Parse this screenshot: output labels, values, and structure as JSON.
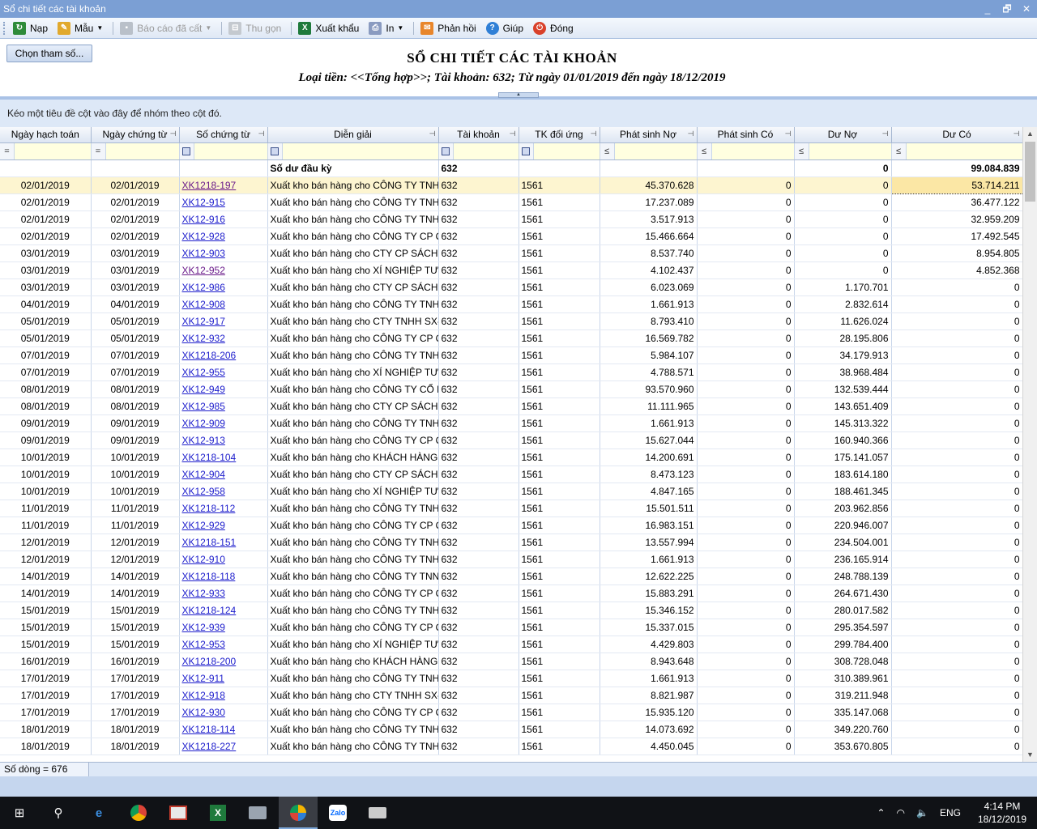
{
  "window": {
    "title": "Sổ chi tiết các tài khoản",
    "minimize": "_",
    "restore": "🗗",
    "close": "✕"
  },
  "toolbar": {
    "nap": "Nạp",
    "mau": "Mẫu",
    "saved_reports": "Báo cáo đã cất",
    "collapse": "Thu gọn",
    "export": "Xuất khẩu",
    "print": "In",
    "feedback": "Phản hồi",
    "help": "Giúp",
    "close": "Đóng"
  },
  "params_button": "Chọn tham số...",
  "report": {
    "title": "SỔ CHI TIẾT CÁC TÀI KHOẢN",
    "subtitle": "Loại tiền: <<Tổng hợp>>; Tài khoản: 632; Từ ngày 01/01/2019 đến ngày 18/12/2019"
  },
  "group_hint": "Kéo một tiêu đề cột vào đây để nhóm theo cột đó.",
  "columns": [
    "Ngày hạch toán",
    "Ngày chứng từ",
    "Số chứng từ",
    "Diễn giải",
    "Tài khoản",
    "TK đối ứng",
    "Phát sinh Nợ",
    "Phát sinh Có",
    "Dư Nợ",
    "Dư Có"
  ],
  "filter_ops": [
    "=",
    "=",
    "",
    "",
    "",
    "",
    "≤",
    "≤",
    "≤",
    "≤"
  ],
  "opening": {
    "label": "Số dư đầu kỳ",
    "account": "632",
    "debit_balance": "0",
    "credit_balance": "99.084.839"
  },
  "rows": [
    [
      "02/01/2019",
      "02/01/2019",
      "XK1218-197",
      "Xuất kho bán hàng cho CÔNG TY TNH",
      "632",
      "1561",
      "45.370.628",
      "0",
      "0",
      "53.714.211"
    ],
    [
      "02/01/2019",
      "02/01/2019",
      "XK12-915",
      "Xuất kho bán hàng cho CÔNG TY TNH",
      "632",
      "1561",
      "17.237.089",
      "0",
      "0",
      "36.477.122"
    ],
    [
      "02/01/2019",
      "02/01/2019",
      "XK12-916",
      "Xuất kho bán hàng cho CÔNG TY TNH",
      "632",
      "1561",
      "3.517.913",
      "0",
      "0",
      "32.959.209"
    ],
    [
      "02/01/2019",
      "02/01/2019",
      "XK12-928",
      "Xuất kho bán hàng cho CÔNG TY CP Q",
      "632",
      "1561",
      "15.466.664",
      "0",
      "0",
      "17.492.545"
    ],
    [
      "03/01/2019",
      "03/01/2019",
      "XK12-903",
      "Xuất kho bán hàng cho CTY CP SÁCH",
      "632",
      "1561",
      "8.537.740",
      "0",
      "0",
      "8.954.805"
    ],
    [
      "03/01/2019",
      "03/01/2019",
      "XK12-952",
      "Xuất kho bán hàng cho XÍ NGHIỆP TƯ",
      "632",
      "1561",
      "4.102.437",
      "0",
      "0",
      "4.852.368"
    ],
    [
      "03/01/2019",
      "03/01/2019",
      "XK12-986",
      "Xuất kho bán hàng cho CTY CP SÁCH",
      "632",
      "1561",
      "6.023.069",
      "0",
      "1.170.701",
      "0"
    ],
    [
      "04/01/2019",
      "04/01/2019",
      "XK12-908",
      "Xuất kho bán hàng cho CÔNG TY TNH",
      "632",
      "1561",
      "1.661.913",
      "0",
      "2.832.614",
      "0"
    ],
    [
      "05/01/2019",
      "05/01/2019",
      "XK12-917",
      "Xuất kho bán hàng cho CTY TNHH SX-",
      "632",
      "1561",
      "8.793.410",
      "0",
      "11.626.024",
      "0"
    ],
    [
      "05/01/2019",
      "05/01/2019",
      "XK12-932",
      "Xuất kho bán hàng cho CÔNG TY CP Q",
      "632",
      "1561",
      "16.569.782",
      "0",
      "28.195.806",
      "0"
    ],
    [
      "07/01/2019",
      "07/01/2019",
      "XK1218-206",
      "Xuất kho bán hàng cho CÔNG TY TNH",
      "632",
      "1561",
      "5.984.107",
      "0",
      "34.179.913",
      "0"
    ],
    [
      "07/01/2019",
      "07/01/2019",
      "XK12-955",
      "Xuất kho bán hàng cho XÍ NGHIỆP TƯ",
      "632",
      "1561",
      "4.788.571",
      "0",
      "38.968.484",
      "0"
    ],
    [
      "08/01/2019",
      "08/01/2019",
      "XK12-949",
      "Xuất kho bán hàng cho CÔNG TY CỔ P",
      "632",
      "1561",
      "93.570.960",
      "0",
      "132.539.444",
      "0"
    ],
    [
      "08/01/2019",
      "08/01/2019",
      "XK12-985",
      "Xuất kho bán hàng cho CTY CP SÁCH",
      "632",
      "1561",
      "11.111.965",
      "0",
      "143.651.409",
      "0"
    ],
    [
      "09/01/2019",
      "09/01/2019",
      "XK12-909",
      "Xuất kho bán hàng cho CÔNG TY TNH",
      "632",
      "1561",
      "1.661.913",
      "0",
      "145.313.322",
      "0"
    ],
    [
      "09/01/2019",
      "09/01/2019",
      "XK12-913",
      "Xuất kho bán hàng cho CÔNG TY CP Q",
      "632",
      "1561",
      "15.627.044",
      "0",
      "160.940.366",
      "0"
    ],
    [
      "10/01/2019",
      "10/01/2019",
      "XK1218-104",
      "Xuất kho bán hàng cho KHÁCH HÀNG",
      "632",
      "1561",
      "14.200.691",
      "0",
      "175.141.057",
      "0"
    ],
    [
      "10/01/2019",
      "10/01/2019",
      "XK12-904",
      "Xuất kho bán hàng cho CTY CP SÁCH",
      "632",
      "1561",
      "8.473.123",
      "0",
      "183.614.180",
      "0"
    ],
    [
      "10/01/2019",
      "10/01/2019",
      "XK12-958",
      "Xuất kho bán hàng cho XÍ NGHIỆP TƯ",
      "632",
      "1561",
      "4.847.165",
      "0",
      "188.461.345",
      "0"
    ],
    [
      "11/01/2019",
      "11/01/2019",
      "XK1218-112",
      "Xuất kho bán hàng cho CÔNG TY TNH",
      "632",
      "1561",
      "15.501.511",
      "0",
      "203.962.856",
      "0"
    ],
    [
      "11/01/2019",
      "11/01/2019",
      "XK12-929",
      "Xuất kho bán hàng cho CÔNG TY CP Q",
      "632",
      "1561",
      "16.983.151",
      "0",
      "220.946.007",
      "0"
    ],
    [
      "12/01/2019",
      "12/01/2019",
      "XK1218-151",
      "Xuất kho bán hàng cho CÔNG TY TNH",
      "632",
      "1561",
      "13.557.994",
      "0",
      "234.504.001",
      "0"
    ],
    [
      "12/01/2019",
      "12/01/2019",
      "XK12-910",
      "Xuất kho bán hàng cho CÔNG TY TNH",
      "632",
      "1561",
      "1.661.913",
      "0",
      "236.165.914",
      "0"
    ],
    [
      "14/01/2019",
      "14/01/2019",
      "XK1218-118",
      "Xuất kho bán hàng cho CÔNG TY TNN",
      "632",
      "1561",
      "12.622.225",
      "0",
      "248.788.139",
      "0"
    ],
    [
      "14/01/2019",
      "14/01/2019",
      "XK12-933",
      "Xuất kho bán hàng cho CÔNG TY CP Q",
      "632",
      "1561",
      "15.883.291",
      "0",
      "264.671.430",
      "0"
    ],
    [
      "15/01/2019",
      "15/01/2019",
      "XK1218-124",
      "Xuất kho bán hàng cho CÔNG TY TNH",
      "632",
      "1561",
      "15.346.152",
      "0",
      "280.017.582",
      "0"
    ],
    [
      "15/01/2019",
      "15/01/2019",
      "XK12-939",
      "Xuất kho bán hàng cho CÔNG TY CP Q",
      "632",
      "1561",
      "15.337.015",
      "0",
      "295.354.597",
      "0"
    ],
    [
      "15/01/2019",
      "15/01/2019",
      "XK12-953",
      "Xuất kho bán hàng cho XÍ NGHIỆP TƯ",
      "632",
      "1561",
      "4.429.803",
      "0",
      "299.784.400",
      "0"
    ],
    [
      "16/01/2019",
      "16/01/2019",
      "XK1218-200",
      "Xuất kho bán hàng cho KHÁCH HÀNG",
      "632",
      "1561",
      "8.943.648",
      "0",
      "308.728.048",
      "0"
    ],
    [
      "17/01/2019",
      "17/01/2019",
      "XK12-911",
      "Xuất kho bán hàng cho CÔNG TY TNH",
      "632",
      "1561",
      "1.661.913",
      "0",
      "310.389.961",
      "0"
    ],
    [
      "17/01/2019",
      "17/01/2019",
      "XK12-918",
      "Xuất kho bán hàng cho CTY TNHH SX-",
      "632",
      "1561",
      "8.821.987",
      "0",
      "319.211.948",
      "0"
    ],
    [
      "17/01/2019",
      "17/01/2019",
      "XK12-930",
      "Xuất kho bán hàng cho CÔNG TY CP Q",
      "632",
      "1561",
      "15.935.120",
      "0",
      "335.147.068",
      "0"
    ],
    [
      "18/01/2019",
      "18/01/2019",
      "XK1218-114",
      "Xuất kho bán hàng cho CÔNG TY TNH",
      "632",
      "1561",
      "14.073.692",
      "0",
      "349.220.760",
      "0"
    ],
    [
      "18/01/2019",
      "18/01/2019",
      "XK1218-227",
      "Xuất kho bán hàng cho CÔNG TY TNH",
      "632",
      "1561",
      "4.450.045",
      "0",
      "353.670.805",
      "0"
    ]
  ],
  "row_count": "Số dòng = 676",
  "taskbar": {
    "time": "4:14 PM",
    "date": "18/12/2019",
    "lang": "ENG"
  }
}
